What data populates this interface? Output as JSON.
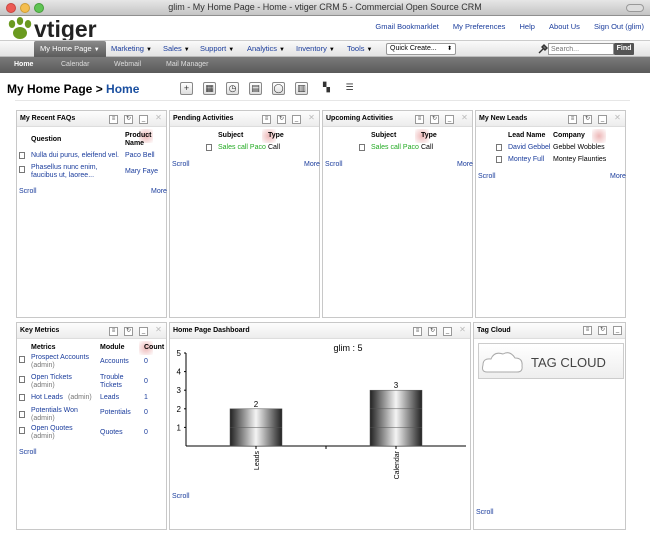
{
  "window": {
    "title": "glim - My Home Page - Home - vtiger CRM 5 - Commercial Open Source CRM"
  },
  "header": {
    "logo_text": "vtiger",
    "links": [
      "Gmail Bookmarklet",
      "My Preferences",
      "Help",
      "About Us",
      "Sign Out (glim)"
    ]
  },
  "modules": [
    {
      "label": "My Home Page"
    },
    {
      "label": "Marketing"
    },
    {
      "label": "Sales"
    },
    {
      "label": "Support"
    },
    {
      "label": "Analytics"
    },
    {
      "label": "Inventory"
    },
    {
      "label": "Tools"
    }
  ],
  "quick_create": {
    "label": "Quick Create..."
  },
  "search": {
    "placeholder": "Search...",
    "button": "Find"
  },
  "subnav": [
    "Home",
    "Calendar",
    "Webmail",
    "Mail Manager"
  ],
  "page": {
    "title_prefix": "My Home Page > ",
    "title_current": "Home"
  },
  "widgets": {
    "faqs": {
      "title": "My Recent FAQs",
      "headers": [
        "Question",
        "Product",
        "Name"
      ],
      "rows": [
        {
          "q1": "Nulla dui purus, eleifend vel.",
          "q2": "",
          "prod": "Paco Bell"
        },
        {
          "q1": "Phasellus nunc enim,",
          "q2": "faucibus ut, laoree...",
          "prod": "Mary Faye"
        }
      ],
      "scroll": "Scroll",
      "more": "More"
    },
    "pending": {
      "title": "Pending Activities",
      "headers": [
        "Subject",
        "Type"
      ],
      "rows": [
        {
          "subject": "Sales call Paco",
          "type": "Call"
        }
      ],
      "scroll": "Scroll",
      "more": "More"
    },
    "upcoming": {
      "title": "Upcoming Activities",
      "headers": [
        "Subject",
        "Type"
      ],
      "rows": [
        {
          "subject": "Sales call Paco",
          "type": "Call"
        }
      ],
      "scroll": "Scroll",
      "more": "More"
    },
    "leads": {
      "title": "My New Leads",
      "headers": [
        "Lead Name",
        "Company"
      ],
      "rows": [
        {
          "name": "David Gebbel",
          "company": "Gebbel Wobbles"
        },
        {
          "name": "Montey Full",
          "company": "Montey Flaunties"
        }
      ],
      "scroll": "Scroll",
      "more": "More"
    },
    "metrics": {
      "title": "Key Metrics",
      "headers": [
        "Metrics",
        "Module",
        "Count"
      ],
      "rows": [
        {
          "m1": "Prospect Accounts",
          "m2": "(admin)",
          "mod1": "Accounts",
          "mod2": "",
          "count": "0"
        },
        {
          "m1": "Open Tickets",
          "m2": "(admin)",
          "mod1": "Trouble",
          "mod2": "Tickets",
          "count": "0"
        },
        {
          "m1": "Hot Leads",
          "m2": "(admin)",
          "mod1": "Leads",
          "mod2": "",
          "count": "1"
        },
        {
          "m1": "Potentials Won",
          "m2": "(admin)",
          "mod1": "Potentials",
          "mod2": "",
          "count": "0"
        },
        {
          "m1": "Open Quotes",
          "m2": "(admin)",
          "mod1": "Quotes",
          "mod2": "",
          "count": "0"
        }
      ],
      "scroll": "Scroll"
    },
    "dashboard": {
      "title": "Home Page Dashboard",
      "scroll": "Scroll"
    },
    "tagcloud": {
      "title": "Tag Cloud",
      "image_text": "TAG CLOUD",
      "scroll": "Scroll"
    }
  },
  "chart_data": {
    "type": "bar",
    "title": "glim : 5",
    "categories": [
      "Leads",
      "Calendar"
    ],
    "values": [
      2,
      3
    ],
    "ylim": [
      0,
      5
    ],
    "yticks": [
      1,
      2,
      3,
      4,
      5
    ],
    "xlabel": "",
    "ylabel": ""
  }
}
